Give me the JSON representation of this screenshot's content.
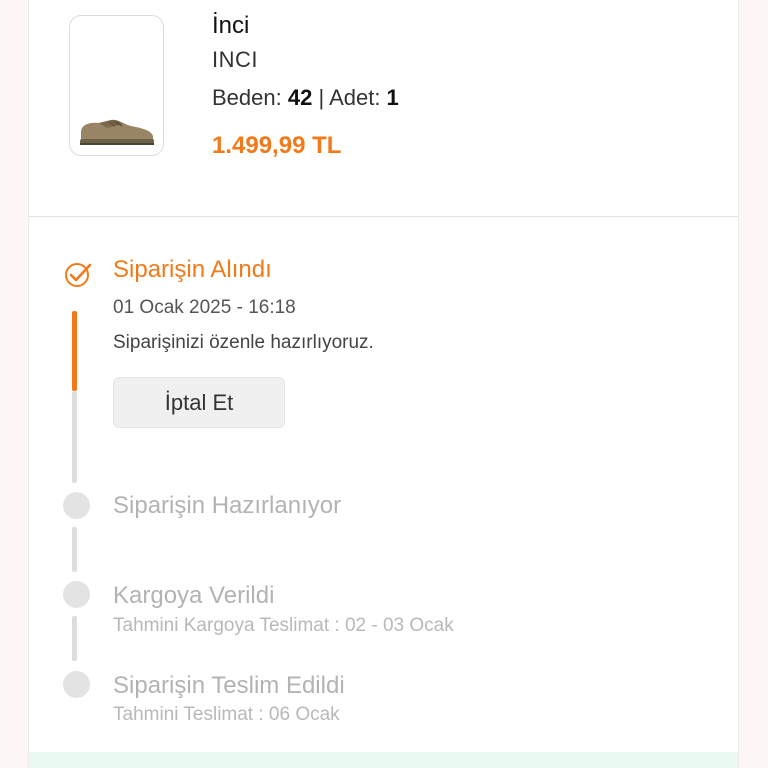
{
  "product": {
    "brand": "İnci",
    "name": "INCI",
    "size_label": "Beden: ",
    "size_value": "42",
    "separator": " | ",
    "qty_label": "Adet: ",
    "qty_value": "1",
    "price": "1.499,99 TL",
    "image_icon": "shoe-icon"
  },
  "timeline": {
    "steps": [
      {
        "title": "Siparişin Alındı",
        "date": "01 Ocak 2025 - 16:18",
        "description": "Siparişinizi özenle hazırlıyoruz.",
        "status": "completed",
        "icon": "check-circle-icon"
      },
      {
        "title": "Siparişin Hazırlanıyor",
        "status": "pending"
      },
      {
        "title": "Kargoya Verildi",
        "subtitle": "Tahmini Kargoya Teslimat : 02 - 03 Ocak",
        "status": "pending"
      },
      {
        "title": "Siparişin Teslim Edildi",
        "subtitle": "Tahmini Teslimat : 06 Ocak",
        "status": "pending"
      }
    ],
    "cancel_label": "İptal Et"
  },
  "colors": {
    "accent": "#f27a1a",
    "inactive": "#b3b3b3",
    "background": "#fcf6f7"
  }
}
